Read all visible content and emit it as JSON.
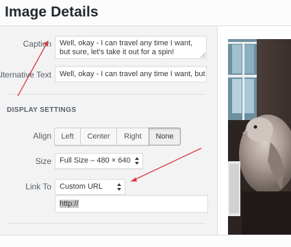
{
  "modal": {
    "title": "Image Details"
  },
  "caption": {
    "label": "Caption",
    "value": "Well, okay - I can travel any time I want, but sure, let's take it out for a spin!"
  },
  "alt_text": {
    "label": "Alternative Text",
    "value": "Well, okay - I can travel any time I want, but sui"
  },
  "display_settings": {
    "heading": "DISPLAY SETTINGS",
    "align": {
      "label": "Align",
      "options": [
        "Left",
        "Center",
        "Right",
        "None"
      ],
      "selected": "None"
    },
    "size": {
      "label": "Size",
      "value": "Full Size – 480 × 640"
    },
    "link_to": {
      "label": "Link To",
      "value": "Custom URL"
    },
    "url": {
      "value": "http://"
    }
  },
  "annotations": {
    "arrow_color": "#d9363e"
  },
  "colors": {
    "panel_background": "#f3f3f3",
    "active_button_border": "#999999"
  }
}
